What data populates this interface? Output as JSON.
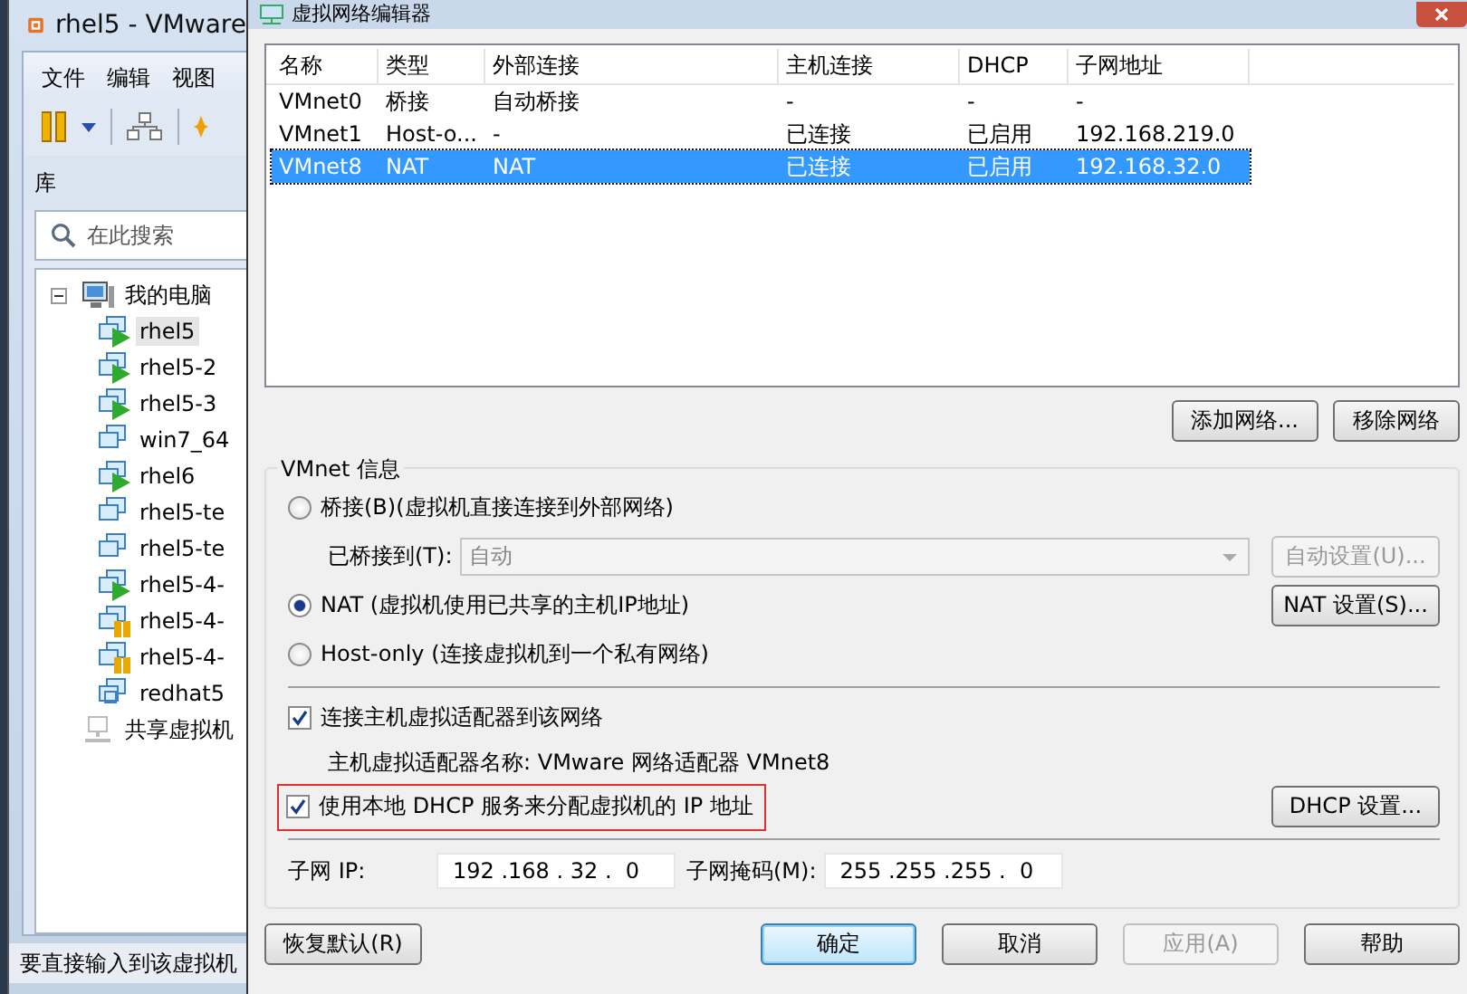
{
  "background_window": {
    "title": "rhel5 - VMware",
    "menu": [
      "文件",
      "编辑",
      "视图"
    ],
    "library_label": "库",
    "search": {
      "placeholder": "在此搜索"
    },
    "tree": [
      {
        "label": "我的电脑",
        "kind": "computer",
        "expanded": true,
        "selected": false,
        "children": [
          {
            "label": "rhel5",
            "kind": "running",
            "selected": true
          },
          {
            "label": "rhel5-2",
            "kind": "running",
            "selected": false
          },
          {
            "label": "rhel5-3",
            "kind": "running",
            "selected": false
          },
          {
            "label": "win7_64",
            "kind": "off",
            "selected": false
          },
          {
            "label": "rhel6",
            "kind": "running",
            "selected": false
          },
          {
            "label": "rhel5-te",
            "kind": "off",
            "selected": false
          },
          {
            "label": "rhel5-te",
            "kind": "off",
            "selected": false
          },
          {
            "label": "rhel5-4-",
            "kind": "running",
            "selected": false
          },
          {
            "label": "rhel5-4-",
            "kind": "paused",
            "selected": false
          },
          {
            "label": "rhel5-4-",
            "kind": "paused",
            "selected": false
          },
          {
            "label": "redhat5",
            "kind": "template",
            "selected": false
          }
        ]
      },
      {
        "label": "共享虚拟机",
        "kind": "shared",
        "selected": false
      }
    ],
    "status_bar": "要直接输入到该虚拟机"
  },
  "dialog": {
    "title": "虚拟网络编辑器",
    "table": {
      "columns": [
        "名称",
        "类型",
        "外部连接",
        "主机连接",
        "DHCP",
        "子网地址"
      ],
      "rows": [
        {
          "cells": [
            "VMnet0",
            "桥接",
            "自动桥接",
            "-",
            "-",
            "-"
          ],
          "selected": false
        },
        {
          "cells": [
            "VMnet1",
            "Host-o...",
            "-",
            "已连接",
            "已启用",
            "192.168.219.0"
          ],
          "selected": false
        },
        {
          "cells": [
            "VMnet8",
            "NAT",
            "NAT",
            "已连接",
            "已启用",
            "192.168.32.0"
          ],
          "selected": true
        }
      ]
    },
    "table_buttons": [
      "添加网络...",
      "移除网络"
    ],
    "info": {
      "title": "VMnet 信息",
      "modes": [
        {
          "kind": "bridged",
          "label": "桥接(B)(虚拟机直接连接到外部网络)",
          "selected": false
        },
        {
          "kind": "nat",
          "label": "NAT (虚拟机使用已共享的主机IP地址)",
          "selected": true,
          "button": "NAT 设置(S)..."
        },
        {
          "kind": "hostonly",
          "label": "Host-only (连接虚拟机到一个私有网络)",
          "selected": false
        }
      ],
      "bridged_to": {
        "label": "已桥接到(T):",
        "value": "自动",
        "button": "自动设置(U)...",
        "disabled": true
      },
      "connect_adapter": {
        "label": "连接主机虚拟适配器到该网络",
        "checked": true
      },
      "adapter_name": "主机虚拟适配器名称: VMware 网络适配器 VMnet8",
      "dhcp": {
        "label": "使用本地 DHCP 服务来分配虚拟机的 IP 地址",
        "checked": true,
        "highlighted": true,
        "button": "DHCP 设置..."
      },
      "subnet_ip": {
        "label": "子网 IP:",
        "value": "192 .168 . 32 .  0"
      },
      "subnet_mask": {
        "label": "子网掩码(M):",
        "value": "255 .255 .255 .  0"
      }
    },
    "footer_buttons": [
      {
        "label": "恢复默认(R)",
        "kind": "normal",
        "disabled": false
      },
      {
        "label": "确定",
        "kind": "default",
        "disabled": false
      },
      {
        "label": "取消",
        "kind": "normal",
        "disabled": false
      },
      {
        "label": "应用(A)",
        "kind": "normal",
        "disabled": true
      },
      {
        "label": "帮助",
        "kind": "normal",
        "disabled": false
      }
    ]
  }
}
